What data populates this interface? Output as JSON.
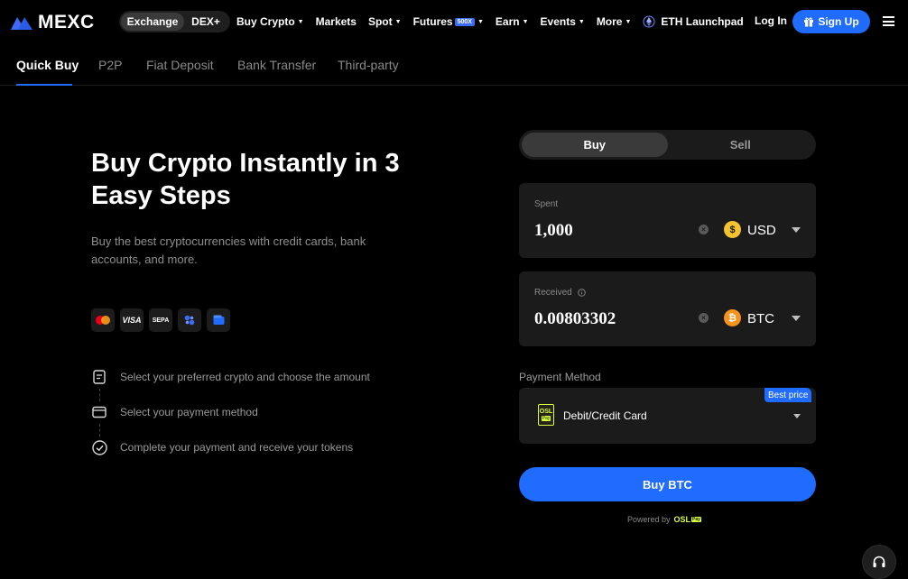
{
  "header": {
    "logo_text": "MEXC",
    "segment": [
      "Exchange",
      "DEX+"
    ],
    "menu": [
      {
        "label": "Buy Crypto",
        "caret": true
      },
      {
        "label": "Markets",
        "caret": false
      },
      {
        "label": "Spot",
        "caret": true
      },
      {
        "label": "Futures",
        "badge": "500X",
        "caret": true
      },
      {
        "label": "Earn",
        "caret": true
      },
      {
        "label": "Events",
        "caret": true
      },
      {
        "label": "More",
        "caret": true
      },
      {
        "label": "ETH Launchpad",
        "caret": false
      }
    ],
    "login": "Log In",
    "signup": "Sign Up"
  },
  "subtabs": [
    "Quick Buy",
    "P2P",
    "Fiat Deposit",
    "Bank Transfer",
    "Third-party"
  ],
  "hero": {
    "title": "Buy Crypto Instantly in 3 Easy Steps",
    "subtitle": "Buy the best cryptocurrencies with credit cards, bank accounts, and more.",
    "pay_methods": [
      "mastercard-icon",
      "visa-icon",
      "sepa-icon",
      "apple-pay-icon",
      "wallet-icon"
    ],
    "pay_labels": {
      "visa": "VISA",
      "sepa": "SEPA"
    },
    "steps": [
      "Select your preferred crypto and choose the amount",
      "Select your payment method",
      "Complete your payment and receive your tokens"
    ]
  },
  "form": {
    "tabs": [
      "Buy",
      "Sell"
    ],
    "spent": {
      "label": "Spent",
      "value": "1,000",
      "currency": "USD",
      "currency_symbol": "$",
      "currency_color": "#f5c330"
    },
    "received": {
      "label": "Received",
      "value": "0.00803302",
      "currency": "BTC",
      "currency_symbol": "₿",
      "currency_color": "#f7931a"
    },
    "payment_label": "Payment Method",
    "payment_method": "Debit/Credit Card",
    "payment_logo": {
      "top": "OSL",
      "bottom": "Pay"
    },
    "best_price": "Best price",
    "buy_button": "Buy BTC",
    "powered_by": "Powered by"
  },
  "colors": {
    "accent": "#1f6cff",
    "osl": "#d8ff3e"
  }
}
